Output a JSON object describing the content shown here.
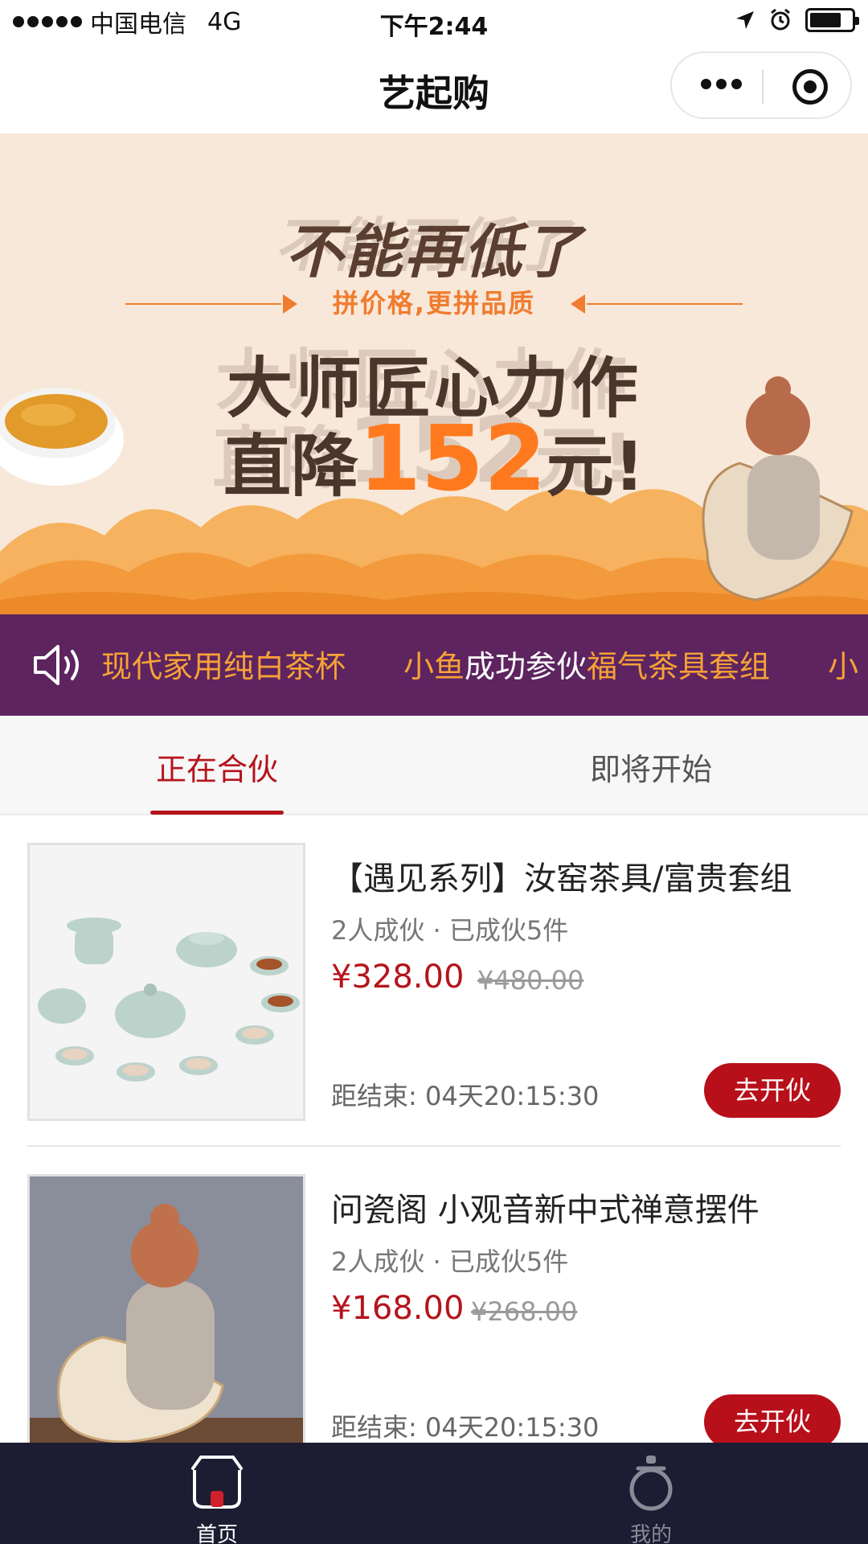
{
  "status_bar": {
    "carrier": "中国电信",
    "network": "4G",
    "time": "下午2:44"
  },
  "nav": {
    "title": "艺起购"
  },
  "banner": {
    "line1": "不能再低了",
    "subtitle": "拼价格,更拼品质",
    "line3": "大师匠心力作",
    "line4_prefix": "直降",
    "line4_amount": "152",
    "line4_suffix": "元!"
  },
  "ticker": {
    "items": [
      {
        "a": "现代家用纯白茶杯",
        "b": ""
      },
      {
        "a": "小鱼",
        "b": "成功参伙"
      },
      {
        "a": "福气茶具套组",
        "b": ""
      },
      {
        "a": "小",
        "b": ""
      }
    ]
  },
  "tabs": {
    "active": "正在合伙",
    "upcoming": "即将开始"
  },
  "products": [
    {
      "title": "【遇见系列】汝窑茶具/富贵套组",
      "group": "2人成伙",
      "sold": "已成伙5件",
      "price": "¥328.00",
      "original_price": "¥480.00",
      "countdown_label": "距结束:",
      "countdown": "04天20:15:30",
      "button": "去开伙"
    },
    {
      "title": "问瓷阁 小观音新中式禅意摆件",
      "group": "2人成伙",
      "sold": "已成伙5件",
      "price": "¥168.00",
      "original_price": "¥268.00",
      "countdown_label": "距结束:",
      "countdown": "04天20:15:30",
      "button": "去开伙"
    }
  ],
  "tabbar": {
    "home": "首页",
    "mine": "我的"
  },
  "colors": {
    "accent_red": "#b5141c",
    "ticker_bg": "#5d2460",
    "ticker_highlight": "#f6a236",
    "tabbar_bg": "#1c1c32",
    "banner_orange": "#ff7a1f"
  }
}
